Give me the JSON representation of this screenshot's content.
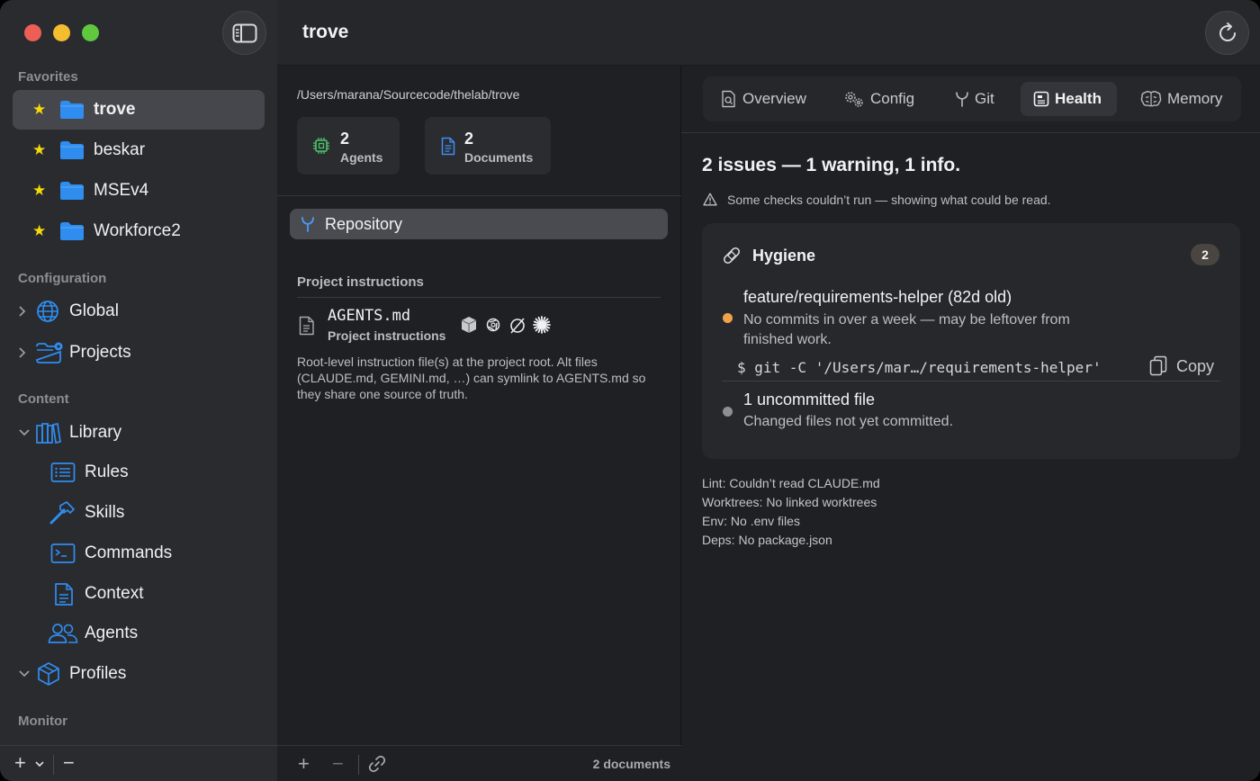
{
  "window": {
    "title": "trove"
  },
  "sidebar": {
    "favorites_header": "Favorites",
    "favorites": [
      {
        "label": "trove",
        "active": true
      },
      {
        "label": "beskar",
        "active": false
      },
      {
        "label": "MSEv4",
        "active": false
      },
      {
        "label": "Workforce2",
        "active": false
      }
    ],
    "configuration_header": "Configuration",
    "configuration": [
      {
        "label": "Global",
        "icon": "globe-icon"
      },
      {
        "label": "Projects",
        "icon": "folder-gear-icon"
      }
    ],
    "content_header": "Content",
    "library": {
      "label": "Library",
      "icon": "books-icon"
    },
    "library_items": [
      {
        "label": "Rules",
        "icon": "list-icon"
      },
      {
        "label": "Skills",
        "icon": "hammer-icon"
      },
      {
        "label": "Commands",
        "icon": "terminal-icon"
      },
      {
        "label": "Context",
        "icon": "document-icon"
      },
      {
        "label": "Agents",
        "icon": "people-icon"
      }
    ],
    "profiles": {
      "label": "Profiles",
      "icon": "cube-icon"
    },
    "monitor_header": "Monitor",
    "footer": {
      "add_label": "+",
      "remove_label": "−"
    }
  },
  "middle": {
    "path": "/Users/marana/Sourcecode/thelab/trove",
    "stats": [
      {
        "number": "2",
        "label": "Agents",
        "icon": "chip-icon"
      },
      {
        "number": "2",
        "label": "Documents",
        "icon": "doc-icon"
      }
    ],
    "repository_label": "Repository",
    "project_instructions_header": "Project instructions",
    "agents_file": {
      "name": "AGENTS.md",
      "subtitle": "Project instructions"
    },
    "description": "Root-level instruction file(s) at the project root. Alt files (CLAUDE.md, GEMINI.md, …) can symlink to AGENTS.md so they share one source of truth.",
    "footer": {
      "count": "2 documents"
    }
  },
  "right": {
    "tabs": [
      {
        "label": "Overview",
        "icon": "doc-search-icon",
        "active": false
      },
      {
        "label": "Config",
        "icon": "gears-icon",
        "active": false
      },
      {
        "label": "Git",
        "icon": "branch-icon",
        "active": false
      },
      {
        "label": "Health",
        "icon": "health-icon",
        "active": true
      },
      {
        "label": "Memory",
        "icon": "brain-icon",
        "active": false
      }
    ],
    "summary": "2 issues — 1 warning, 1 info.",
    "warning_note": "Some checks couldn’t run — showing what could be read.",
    "hygiene": {
      "title": "Hygiene",
      "badge": "2",
      "issues": [
        {
          "title": "feature/requirements-helper (82d old)",
          "desc": "No commits in over a week — may be leftover from finished work.",
          "severity": "warning",
          "color": "#f0a24a"
        },
        {
          "title": "1 uncommitted file",
          "desc": "Changed files not yet committed.",
          "severity": "info",
          "color": "#8e8f94"
        }
      ],
      "command": "$ git -C '/Users/mar…/requirements-helper'",
      "copy_label": "Copy"
    },
    "lint": [
      "Lint: Couldn’t read CLAUDE.md",
      "Worktrees: No linked worktrees",
      "Env: No .env files",
      "Deps: No package.json"
    ]
  }
}
